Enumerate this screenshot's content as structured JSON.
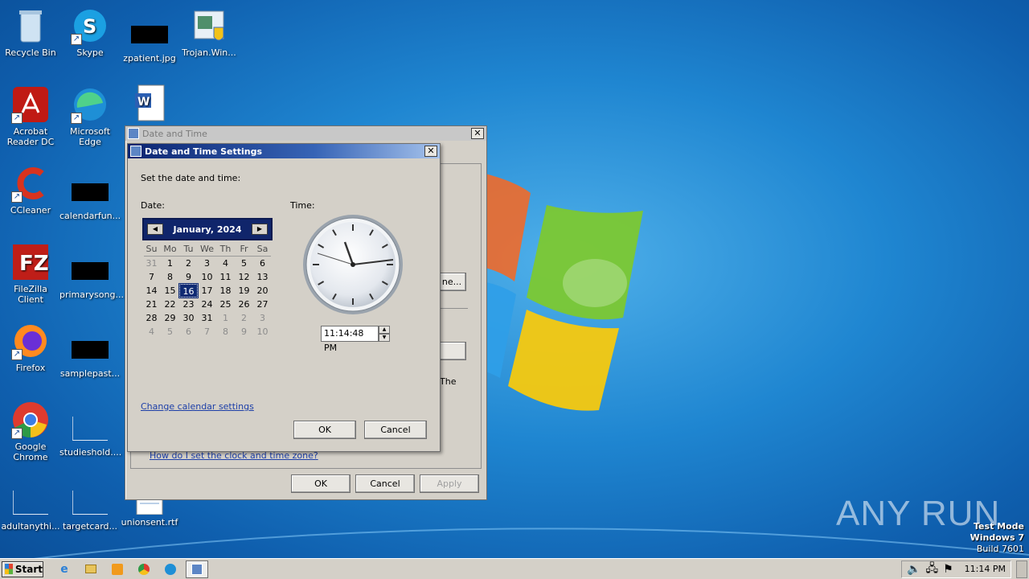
{
  "desktop": {
    "icons": [
      {
        "label": "Recycle Bin"
      },
      {
        "label": "Skype"
      },
      {
        "label": "zpatient.jpg"
      },
      {
        "label": "Trojan.Win..."
      },
      {
        "label": "Acrobat Reader DC"
      },
      {
        "label": "Microsoft Edge"
      },
      {
        "label": "CCleaner"
      },
      {
        "label": "calendarfun..."
      },
      {
        "label": "FileZilla Client"
      },
      {
        "label": "primarysong..."
      },
      {
        "label": "Firefox"
      },
      {
        "label": "samplepast..."
      },
      {
        "label": "Google Chrome"
      },
      {
        "label": "studieshold...."
      },
      {
        "label": "adultanythi..."
      },
      {
        "label": "targetcard..."
      },
      {
        "label": "unionsent.rtf"
      }
    ]
  },
  "outer_window": {
    "title": "Date and Time",
    "partial_button": "ne...",
    "partial_text": "The",
    "help_link": "How do I set the clock and time zone?",
    "ok": "OK",
    "cancel": "Cancel",
    "apply": "Apply"
  },
  "dialog": {
    "title": "Date and Time Settings",
    "instruction": "Set the date and time:",
    "date_label": "Date:",
    "time_label": "Time:",
    "month_label": "January, 2024",
    "prev_arrow": "◀",
    "next_arrow": "▶",
    "weekdays": [
      "Su",
      "Mo",
      "Tu",
      "We",
      "Th",
      "Fr",
      "Sa"
    ],
    "weeks": [
      [
        "31",
        "1",
        "2",
        "3",
        "4",
        "5",
        "6"
      ],
      [
        "7",
        "8",
        "9",
        "10",
        "11",
        "12",
        "13"
      ],
      [
        "14",
        "15",
        "16",
        "17",
        "18",
        "19",
        "20"
      ],
      [
        "21",
        "22",
        "23",
        "24",
        "25",
        "26",
        "27"
      ],
      [
        "28",
        "29",
        "30",
        "31",
        "1",
        "2",
        "3"
      ],
      [
        "4",
        "5",
        "6",
        "7",
        "8",
        "9",
        "10"
      ]
    ],
    "selected_day": "16",
    "time_value": "11:14:48 PM",
    "change_calendar_link": "Change calendar settings",
    "ok": "OK",
    "cancel": "Cancel"
  },
  "taskbar": {
    "start_label": "Start",
    "clock": "11:14 PM",
    "apps": [
      "ie-icon",
      "explorer-icon",
      "media-player-icon",
      "chrome-icon",
      "edge-icon",
      "date-time-icon"
    ]
  },
  "watermark": {
    "line1": "Test Mode",
    "line2": "Windows 7",
    "line3": "Build 7601",
    "brand": "ANY RUN"
  }
}
